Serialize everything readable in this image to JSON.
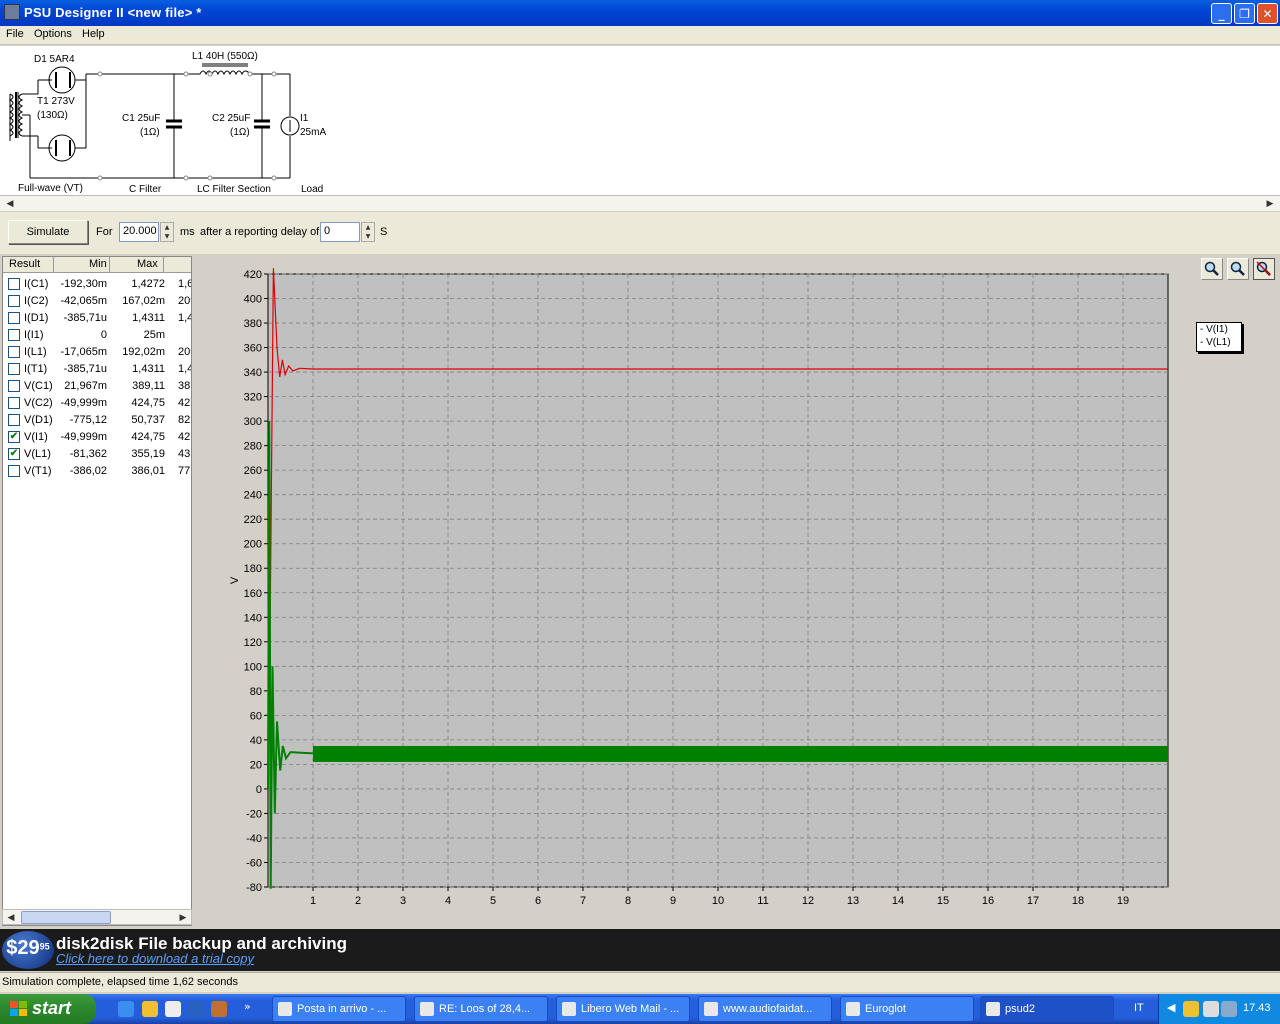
{
  "window": {
    "title": "PSU Designer II  <new file> *"
  },
  "menu": [
    "File",
    "Options",
    "Help"
  ],
  "schematic": {
    "rectifier_label": "D1 5AR4",
    "transformer_label": "T1 273V",
    "transformer_res": "(130Ω)",
    "inductor_label": "L1 40H (550Ω)",
    "c1_label": "C1 25uF",
    "c1_res": "(1Ω)",
    "c2_label": "C2 25uF",
    "c2_res": "(1Ω)",
    "load_label": "I1",
    "load_value": "25mA",
    "section_rect": "Full-wave (VT)",
    "section_cfilter": "C Filter",
    "section_lc": "LC Filter Section",
    "section_load": "Load"
  },
  "simbar": {
    "simulate_label": "Simulate",
    "for_label": "For",
    "duration_value": "20.000",
    "duration_unit": "ms",
    "delay_label": "after a reporting delay of",
    "delay_value": "0",
    "delay_unit": "S"
  },
  "results": {
    "headers": {
      "result": "Result",
      "min": "Min",
      "max": "Max"
    },
    "rows": [
      {
        "name": "I(C1)",
        "min": "-192,30m",
        "max": "1,4272",
        "extra": "1,6",
        "checked": false
      },
      {
        "name": "I(C2)",
        "min": "-42,065m",
        "max": "167,02m",
        "extra": "209,",
        "checked": false
      },
      {
        "name": "I(D1)",
        "min": "-385,71u",
        "max": "1,4311",
        "extra": "1,4",
        "checked": false
      },
      {
        "name": "I(I1)",
        "min": "0",
        "max": "25m",
        "extra": "",
        "checked": false
      },
      {
        "name": "I(L1)",
        "min": "-17,065m",
        "max": "192,02m",
        "extra": "209,",
        "checked": false
      },
      {
        "name": "I(T1)",
        "min": "-385,71u",
        "max": "1,4311",
        "extra": "1,4",
        "checked": false
      },
      {
        "name": "V(C1)",
        "min": "21,967m",
        "max": "389,11",
        "extra": "38",
        "checked": false
      },
      {
        "name": "V(C2)",
        "min": "-49,999m",
        "max": "424,75",
        "extra": "42",
        "checked": false
      },
      {
        "name": "V(D1)",
        "min": "-775,12",
        "max": "50,737",
        "extra": "82",
        "checked": false
      },
      {
        "name": "V(I1)",
        "min": "-49,999m",
        "max": "424,75",
        "extra": "42",
        "checked": true
      },
      {
        "name": "V(L1)",
        "min": "-81,362",
        "max": "355,19",
        "extra": "43",
        "checked": true
      },
      {
        "name": "V(T1)",
        "min": "-386,02",
        "max": "386,01",
        "extra": "77",
        "checked": false
      }
    ]
  },
  "chart_data": {
    "type": "line",
    "ylabel": "V",
    "xlabel": "",
    "xlim": [
      0,
      20
    ],
    "ylim": [
      -80,
      420
    ],
    "x_ticks": [
      1,
      2,
      3,
      4,
      5,
      6,
      7,
      8,
      9,
      10,
      11,
      12,
      13,
      14,
      15,
      16,
      17,
      18,
      19
    ],
    "y_ticks": [
      420,
      400,
      380,
      360,
      340,
      320,
      300,
      280,
      260,
      240,
      220,
      200,
      180,
      160,
      140,
      120,
      100,
      80,
      60,
      40,
      20,
      0,
      -20,
      -40,
      -60,
      -80
    ],
    "grid": true,
    "legend_position": "top-right",
    "series": [
      {
        "name": "V(I1)",
        "color": "#e00000",
        "points": [
          [
            0,
            0
          ],
          [
            0.05,
            150
          ],
          [
            0.12,
            424.75
          ],
          [
            0.2,
            360
          ],
          [
            0.26,
            336
          ],
          [
            0.32,
            350
          ],
          [
            0.38,
            338
          ],
          [
            0.46,
            345
          ],
          [
            0.55,
            341
          ],
          [
            0.7,
            343
          ],
          [
            1,
            342.5
          ],
          [
            20,
            342.5
          ]
        ]
      },
      {
        "name": "V(L1)",
        "color": "#008000",
        "points": [
          [
            0,
            0
          ],
          [
            0.03,
            300
          ],
          [
            0.06,
            -81.36
          ],
          [
            0.1,
            100
          ],
          [
            0.15,
            -20
          ],
          [
            0.2,
            55
          ],
          [
            0.27,
            15
          ],
          [
            0.33,
            35
          ],
          [
            0.4,
            25
          ],
          [
            0.5,
            30
          ],
          [
            1,
            29
          ],
          [
            20,
            29
          ]
        ],
        "ripple_band": [
          22,
          35
        ]
      }
    ]
  },
  "legend": [
    "- V(I1)",
    "- V(L1)"
  ],
  "banner": {
    "price": "$29",
    "price_cents": "95",
    "title": "disk2disk File backup and archiving",
    "link": "Click here to download a trial copy"
  },
  "status": {
    "text": "Simulation complete, elapsed time 1,62 seconds"
  },
  "taskbar": {
    "start_label": "start",
    "tasks": [
      {
        "label": "Posta in arrivo - ...",
        "active": false
      },
      {
        "label": "RE: Loos of 28,4...",
        "active": false
      },
      {
        "label": "Libero Web Mail - ...",
        "active": false
      },
      {
        "label": "www.audiofaidat...",
        "active": false
      },
      {
        "label": "Euroglot",
        "active": false
      },
      {
        "label": "psud2",
        "active": true
      }
    ],
    "language": "IT",
    "clock": "17.43"
  },
  "colors": {
    "title_bar": "#0045d4",
    "plot_bg": "#c0c0c0",
    "series1": "#e00000",
    "series2": "#008000"
  }
}
